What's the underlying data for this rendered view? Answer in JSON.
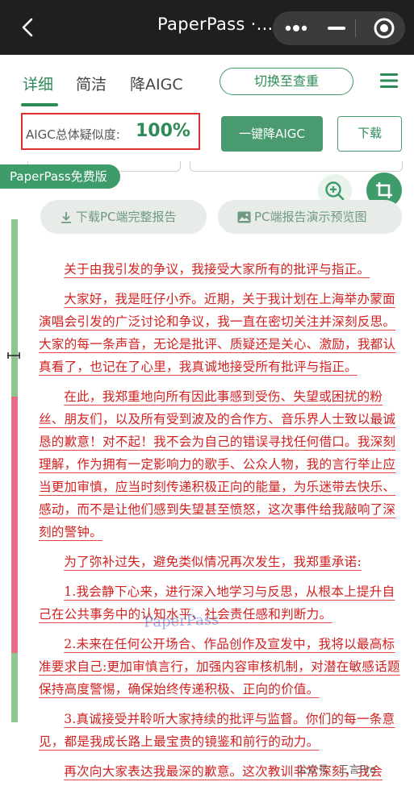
{
  "topbar": {
    "title": "PaperPass ·..."
  },
  "tabs": {
    "items": [
      "详细",
      "简洁",
      "降AIGC"
    ],
    "active": "详细",
    "switch_label": "切换至查重"
  },
  "aigc": {
    "label": "AIGC总体疑似度:",
    "value": "100%",
    "reduce_label": "一键降AIGC",
    "download_label": "下载"
  },
  "badge": {
    "label": "PaperPass免费版"
  },
  "actions": {
    "download_pc": "下载PC端完整报告",
    "preview_pc": "PC端报告演示预览图"
  },
  "progress_segments": [
    {
      "status": "low",
      "fraction": 0.285,
      "color": "#8fc58f"
    },
    {
      "status": "high",
      "fraction": 0.41,
      "color": "#e46f86"
    },
    {
      "status": "low",
      "fraction": 0.111,
      "color": "#8fc58f"
    }
  ],
  "document": {
    "paragraphs": [
      "关于由我引发的争议，我接受大家所有的批评与指正。",
      "大家好，我是旺仔小乔。近期，关于我计划在上海举办蒙面演唱会引发的广泛讨论和争议，我一直在密切关注并深刻反思。大家的每一条声音，无论是批评、质疑还是关心、激励，我都认真看了，也记在了心里，我真诚地接受所有批评与指正。",
      "在此，我郑重地向所有因此事感到受伤、失望或困扰的粉丝、朋友们，以及所有受到波及的合作方、音乐界人士致以最诚恳的歉意！对不起！我不会为自己的错误寻找任何借口。我深刻理解，作为拥有一定影响力的歌手、公众人物，我的言行举止应当更加审慎，应当时刻传递积极正向的能量，为乐迷带去快乐、感动，而不是让他们感到失望甚至愤怒，这次事件给我敲响了深刻的警钟。",
      "为了弥补过失，避免类似情况再次发生，我郑重承诺:",
      "1.我会静下心来，进行深入地学习与反思，从根本上提升自己在公共事务中的认知水平、社会责任感和判断力。",
      "2.未来在任何公开场合、作品创作及宣发中，我将以最高标准要求自己:更加审慎言行，加强内容审核机制，对潜在敏感话题保持高度警惕，确保始终传递积极、正向的价值。",
      "3.真诚接受并聆听大家持续的批评与监督。你们的每一条意见，都是我成长路上最宝贵的镜鉴和前行的动力。",
      "再次向大家表达我最深的歉意。这次教训非常深刻，我会"
    ]
  },
  "watermarks": {
    "center": "PaperPass",
    "corner": "公众号 · 三言Pro"
  }
}
